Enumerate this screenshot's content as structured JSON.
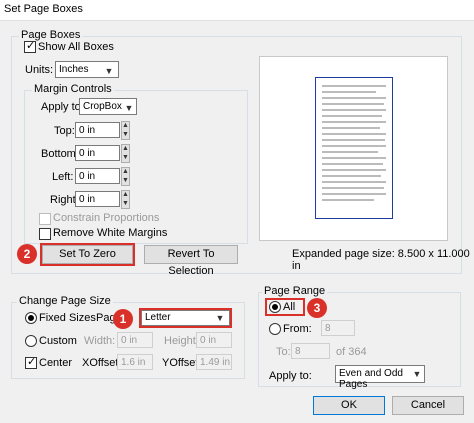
{
  "window": {
    "title": "Set Page Boxes"
  },
  "page_boxes": {
    "legend": "Page Boxes",
    "show_all_boxes": "Show All Boxes",
    "units_label": "Units:",
    "units_value": "Inches"
  },
  "margin_controls": {
    "legend": "Margin Controls",
    "apply_to_label": "Apply to:",
    "apply_to_value": "CropBox",
    "top_label": "Top:",
    "top_value": "0 in",
    "bottom_label": "Bottom:",
    "bottom_value": "0 in",
    "left_label": "Left:",
    "left_value": "0 in",
    "right_label": "Right:",
    "right_value": "0 in",
    "constrain_proportions": "Constrain Proportions",
    "remove_white_margins": "Remove White Margins",
    "set_to_zero": "Set To Zero",
    "revert_to_selection": "Revert To Selection"
  },
  "preview": {
    "expanded_size": "Expanded page size: 8.500 x 11.000 in"
  },
  "change_page_size": {
    "legend": "Change Page Size",
    "fixed_sizes": "Fixed Sizes",
    "page_sizes_label": "Page S",
    "page_size_value": "Letter",
    "custom": "Custom",
    "width_label": "Width:",
    "width_value": "0 in",
    "height_label": "Height:",
    "height_value": "0 in",
    "center": "Center",
    "xoffset_label": "XOffset:",
    "xoffset_value": "1.6 in",
    "yoffset_label": "YOffset:",
    "yoffset_value": "1.49 in"
  },
  "page_range": {
    "legend": "Page Range",
    "all": "All",
    "from_label": "From:",
    "from_value": "8",
    "to_label": "To:",
    "to_value": "8",
    "of_total": "of 364",
    "apply_to_label": "Apply to:",
    "apply_to_value": "Even and Odd Pages"
  },
  "buttons": {
    "ok": "OK",
    "cancel": "Cancel"
  },
  "callouts": {
    "one": "1",
    "two": "2",
    "three": "3"
  },
  "colors": {
    "callout": "#d9302a",
    "page_border": "#1d3ea0",
    "accent": "#0078d7"
  },
  "icons": {
    "spin_up": "caret-up-icon",
    "spin_down": "caret-down-icon",
    "dropdown": "chevron-down-icon"
  }
}
